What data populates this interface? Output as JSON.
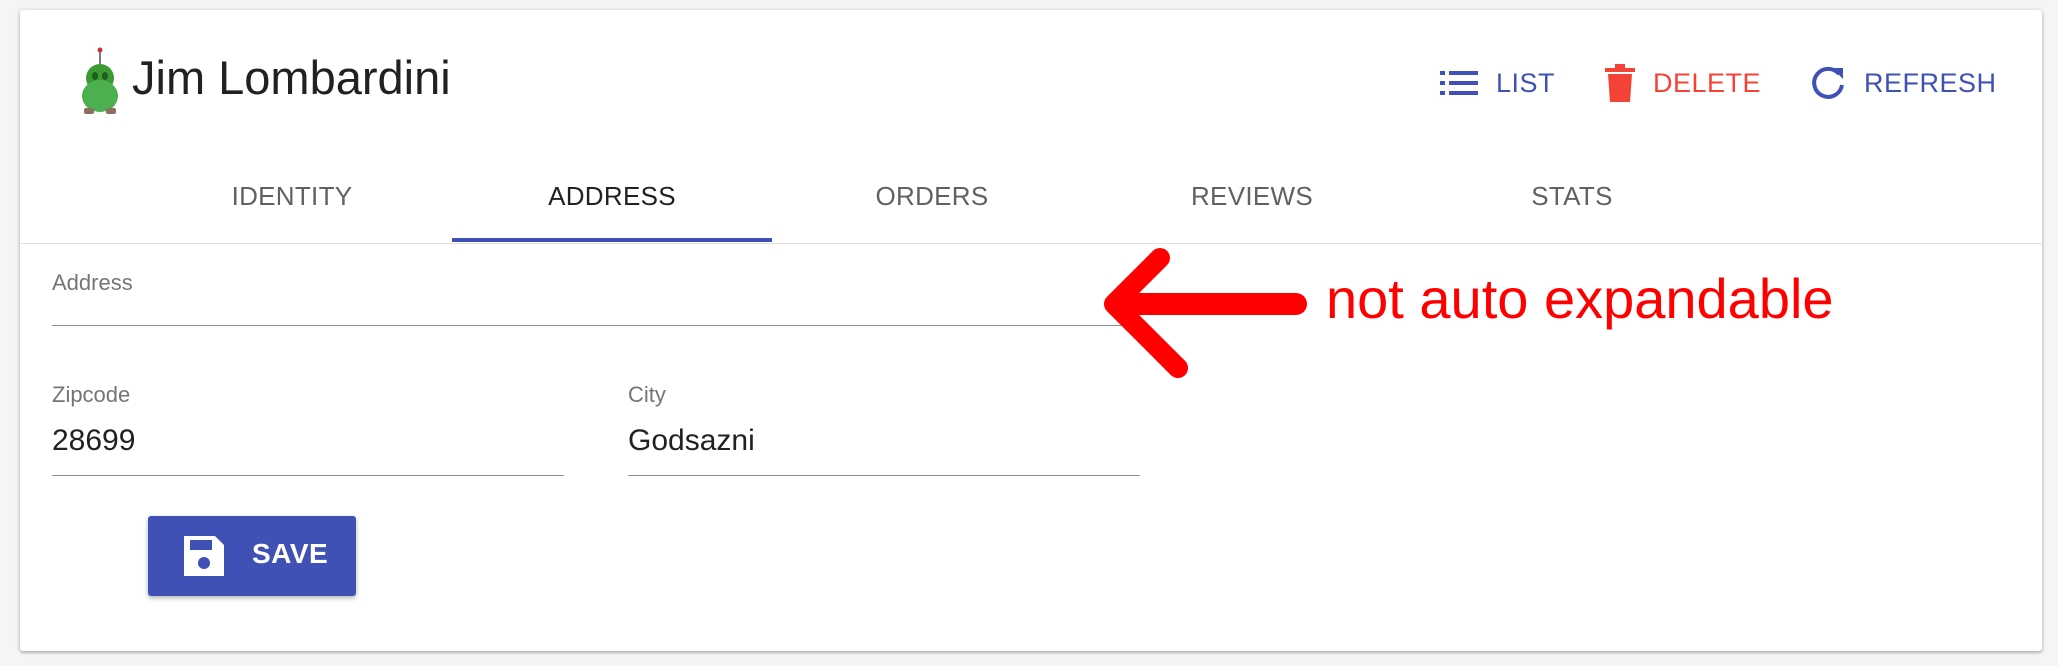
{
  "header": {
    "title": "Jim Lombardini",
    "actions": {
      "list_label": "LIST",
      "delete_label": "DELETE",
      "refresh_label": "REFRESH"
    }
  },
  "tabs": [
    {
      "label": "IDENTITY"
    },
    {
      "label": "ADDRESS",
      "active": true
    },
    {
      "label": "ORDERS"
    },
    {
      "label": "REVIEWS"
    },
    {
      "label": "STATS"
    }
  ],
  "form": {
    "address": {
      "label": "Address",
      "value": ""
    },
    "zipcode": {
      "label": "Zipcode",
      "value": "28699"
    },
    "city": {
      "label": "City",
      "value": "Godsazni"
    },
    "save_label": "SAVE"
  },
  "annotation": {
    "text": "not auto expandable"
  },
  "colors": {
    "primary": "#3f51b5",
    "danger": "#f44336",
    "annotation": "#ff0000"
  },
  "icons": {
    "avatar": "avatar-image",
    "list": "list-icon",
    "delete": "trash-icon",
    "refresh": "refresh-icon",
    "save": "floppy-disk-icon"
  }
}
